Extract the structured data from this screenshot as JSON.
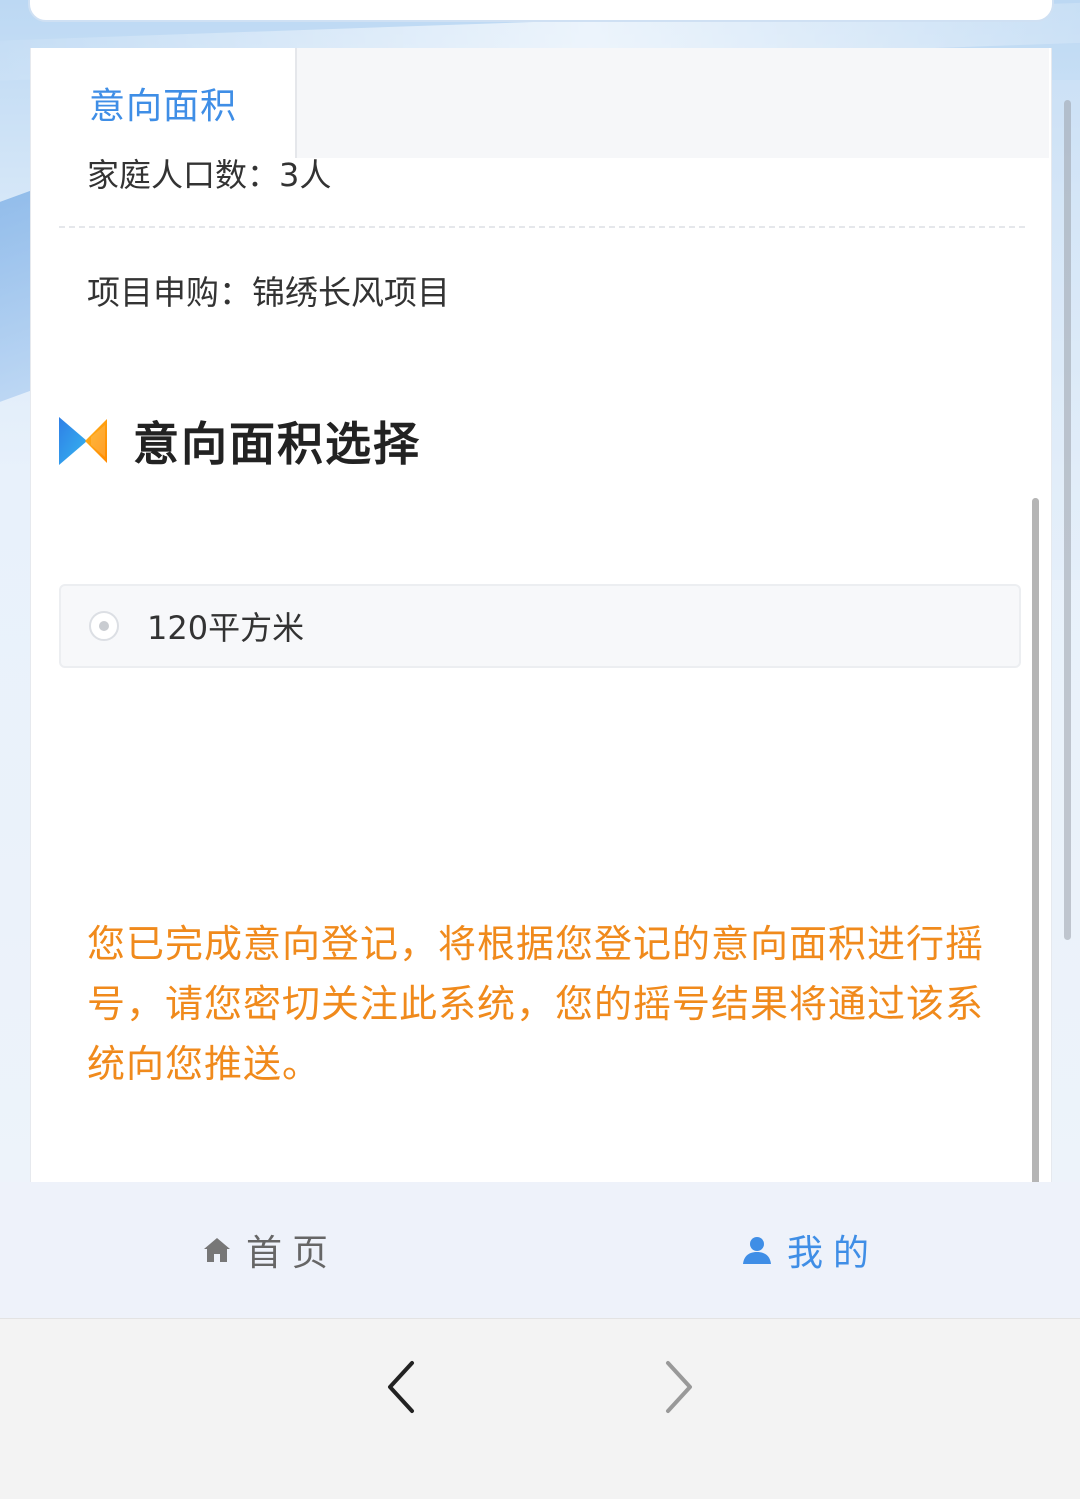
{
  "tabs": [
    {
      "label": "意向面积",
      "active": true
    }
  ],
  "info": {
    "household_label": "家庭人口数：",
    "household_value": "3人",
    "project_label": "项目申购：",
    "project_value": "锦绣长风项目"
  },
  "section": {
    "title": "意向面积选择"
  },
  "options": [
    {
      "label": "120平方米",
      "selected": true
    }
  ],
  "notice": "您已完成意向登记，将根据您登记的意向面积进行摇号，请您密切关注此系统，您的摇号结果将通过该系统向您推送。",
  "bottom_nav": {
    "home_label": "首页",
    "mine_label": "我的",
    "active": "mine"
  },
  "browser": {
    "back_icon": "chevron-left-icon",
    "forward_icon": "chevron-right-icon"
  },
  "colors": {
    "accent": "#3f8ee6",
    "notice": "#f08a1c",
    "text": "#333333"
  }
}
